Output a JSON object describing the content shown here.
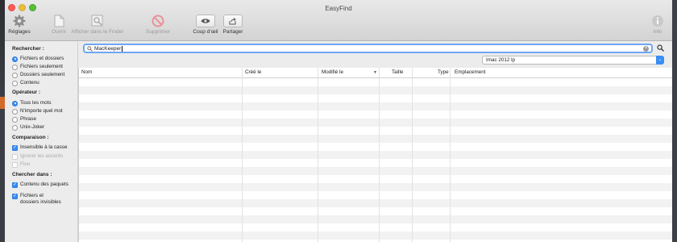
{
  "window": {
    "title": "EasyFind"
  },
  "toolbar": {
    "settings": "Réglages",
    "open": "Ouvrir",
    "show_in_finder": "Afficher dans le Finder",
    "delete": "Supprimer",
    "quick_look": "Coup d'œil",
    "share": "Partager",
    "info": "Info"
  },
  "search": {
    "value": "MacKeeper",
    "clear_glyph": "×"
  },
  "volume": {
    "selected": "Imac 2012 lp"
  },
  "sidebar": {
    "search_heading": "Rechercher :",
    "search_options": [
      "Fichiers et dossiers",
      "Fichiers seulement",
      "Dossiers seulement",
      "Contenu"
    ],
    "operator_heading": "Opérateur :",
    "operator_options": [
      "Tous les mots",
      "N'importe quel mot",
      "Phrase",
      "Unix-Joker"
    ],
    "comparison_heading": "Comparaison :",
    "comparison_options": [
      "Insensible à la casse",
      "Ignorer les accents",
      "Flou"
    ],
    "look_heading": "Chercher dans :",
    "look_options": [
      "Contenu des paquets",
      "Fichiers et",
      "dossiers invisibles"
    ]
  },
  "table": {
    "columns": [
      "Nom",
      "Créé le",
      "Modifié le",
      "Taille",
      "Type",
      "Emplacement"
    ],
    "sort_glyph": "▼"
  }
}
